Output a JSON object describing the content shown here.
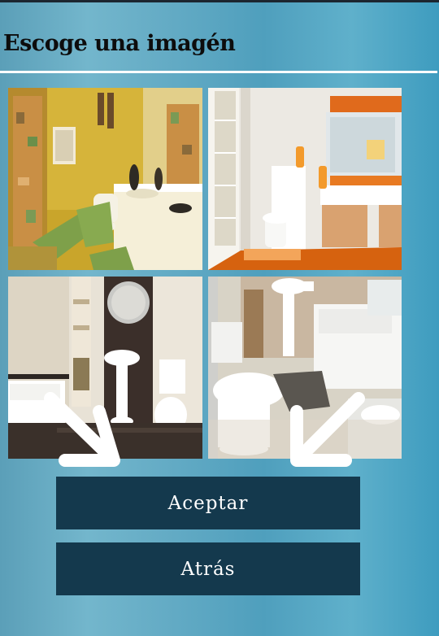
{
  "page": {
    "title": "Escoge una imagén"
  },
  "gallery": {
    "images": [
      {
        "subject": "yellow bathroom with green rugs"
      },
      {
        "subject": "white and orange bathroom"
      },
      {
        "subject": "bathroom with bathtub and round mirror"
      },
      {
        "subject": "bathroom with toilet and bathtub"
      }
    ]
  },
  "buttons": {
    "accept_label": "Aceptar",
    "back_label": "Atrás"
  },
  "colors": {
    "button_bg": "#14394d",
    "button_text": "#ffffff",
    "divider": "#ffffff",
    "title_text": "#0d0d0d"
  },
  "icons": {
    "left_arrow": "arrow-down-right-icon",
    "right_arrow": "arrow-down-left-icon"
  }
}
